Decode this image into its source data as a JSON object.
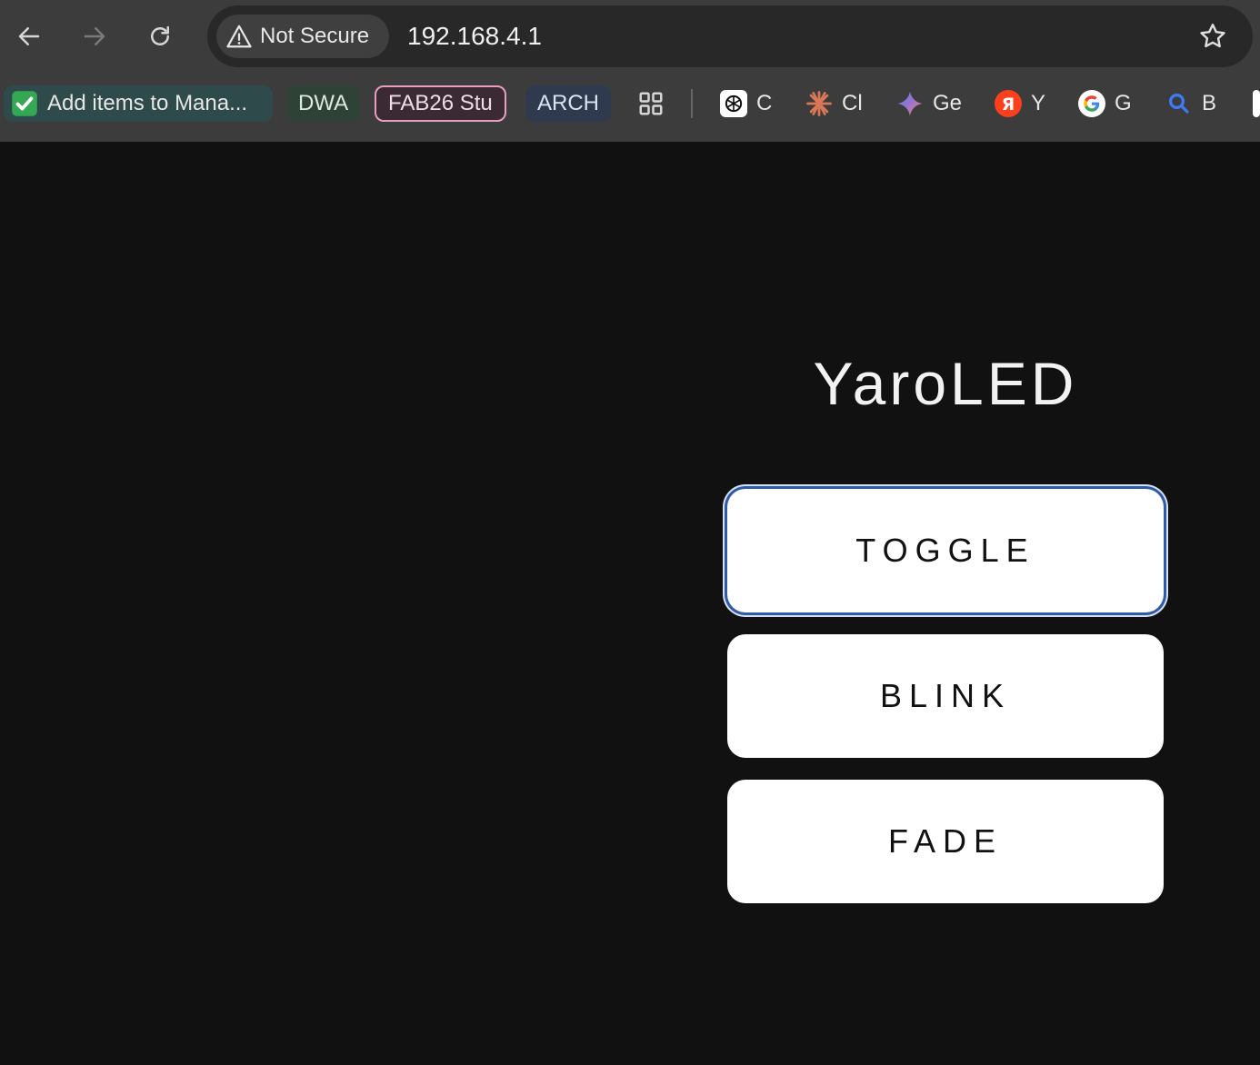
{
  "browser": {
    "security_label": "Not Secure",
    "url": "192.168.4.1",
    "icons": {
      "back": "back-arrow-icon",
      "forward": "forward-arrow-icon",
      "reload": "reload-icon",
      "security": "warning-triangle-icon",
      "bookmark": "star-icon"
    }
  },
  "bookmarks": [
    {
      "label": "Add items to Mana...",
      "icon": "checkmark-icon",
      "color": "#2f4a4a"
    },
    {
      "label": "DWA",
      "color": "#2e4236"
    },
    {
      "label": "FAB26 Stu",
      "color": "#3b2a33",
      "border": "#e79fc0"
    },
    {
      "label": "ARCH",
      "color": "#2f3a4e"
    },
    {
      "label": "",
      "icon": "apps-grid-icon"
    },
    {
      "label": "C",
      "icon": "chatgpt-icon"
    },
    {
      "label": "Cl",
      "icon": "claude-icon"
    },
    {
      "label": "Ge",
      "icon": "gemini-icon"
    },
    {
      "label": "Y",
      "icon": "yandex-icon"
    },
    {
      "label": "G",
      "icon": "google-icon"
    },
    {
      "label": "B",
      "icon": "search-icon"
    }
  ],
  "app": {
    "title": "YaroLED",
    "buttons": [
      {
        "label": "TOGGLE",
        "focused": true
      },
      {
        "label": "BLINK"
      },
      {
        "label": "FADE"
      }
    ]
  },
  "colors": {
    "page_background": "#111111",
    "button_background": "#ffffff",
    "focus_ring": "#2f5aa8"
  }
}
